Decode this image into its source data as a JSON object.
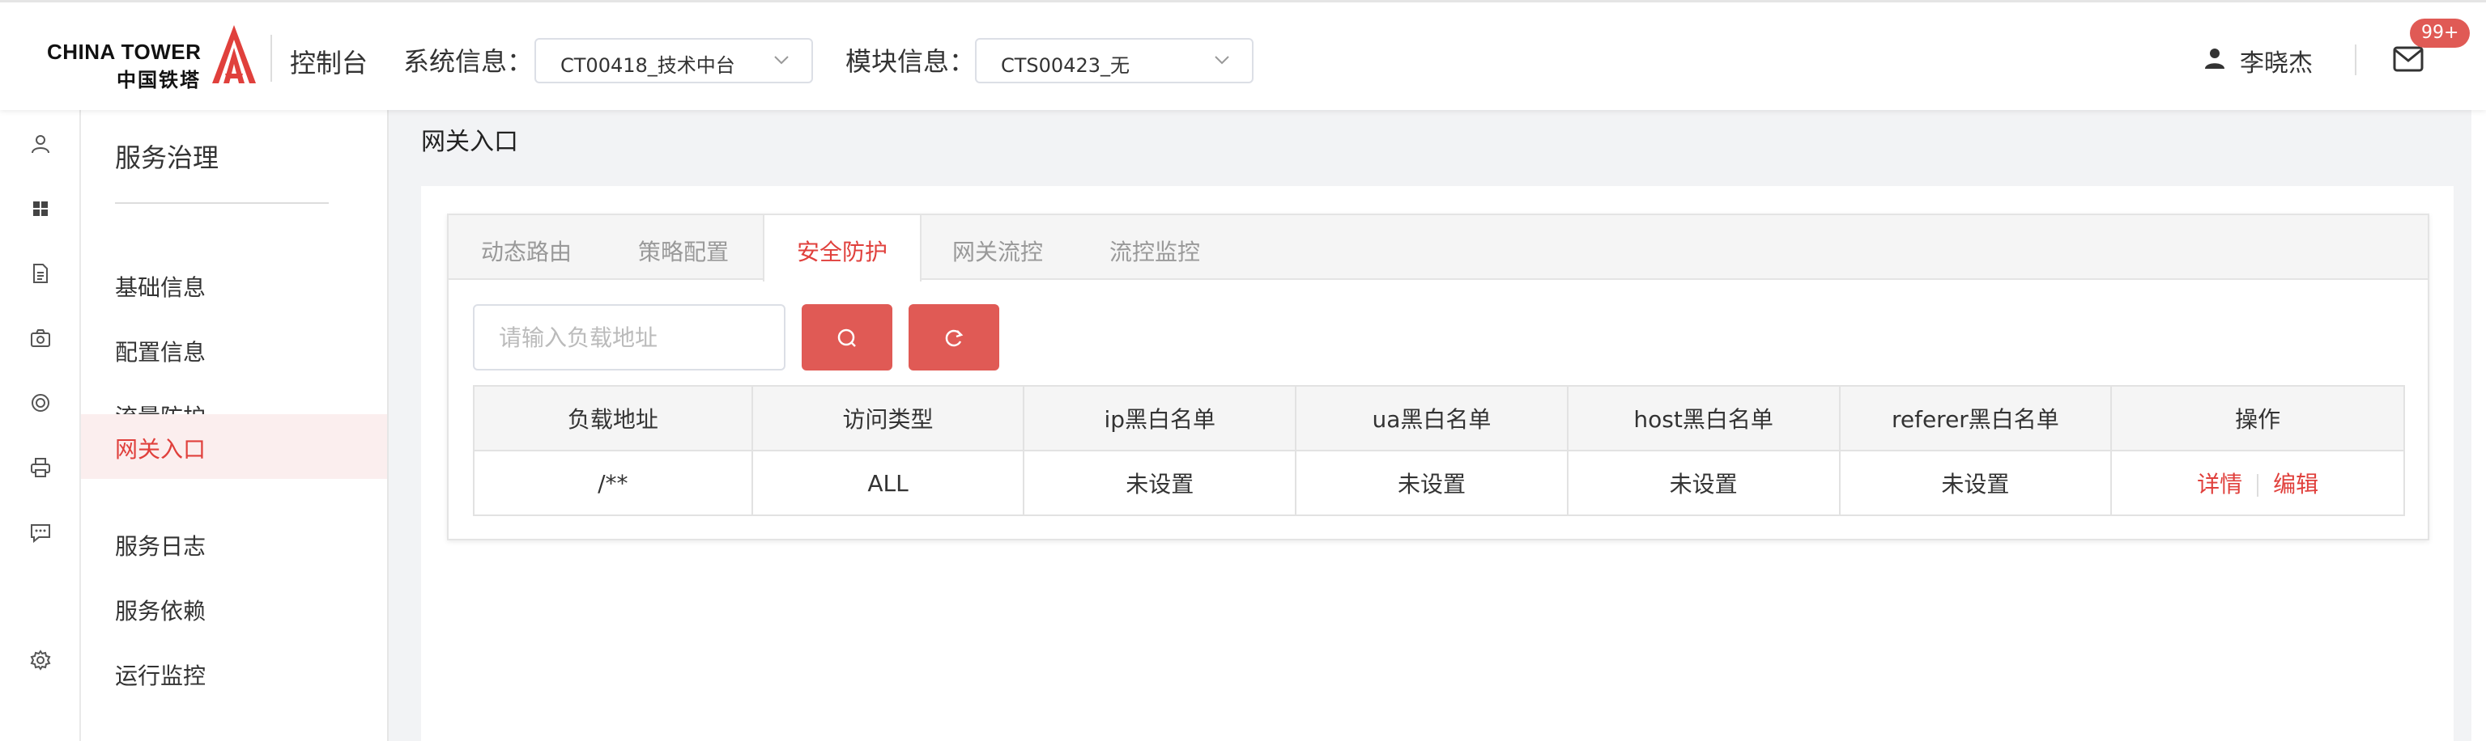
{
  "header": {
    "logo_en": "CHINA TOWER",
    "logo_cn": "中国铁塔",
    "console_title": "控制台",
    "system_label": "系统信息：",
    "system_value": "CT00418_技术中台",
    "module_label": "模块信息：",
    "module_value": "CTS00423_无",
    "user_name": "李晓杰",
    "mail_badge": "99+"
  },
  "sidebar": {
    "title": "服务治理",
    "items": [
      {
        "label": "基础信息"
      },
      {
        "label": "配置信息"
      },
      {
        "label": "流量防护"
      },
      {
        "label": "网关入口"
      },
      {
        "label": "服务日志"
      },
      {
        "label": "服务依赖"
      },
      {
        "label": "运行监控"
      }
    ],
    "active_index": 3
  },
  "rail_icons": [
    "user-icon",
    "grid-icon",
    "document-icon",
    "camera-icon",
    "lifebuoy-icon",
    "printer-icon",
    "chat-icon",
    "gear-icon"
  ],
  "main": {
    "page_title": "网关入口",
    "tabs": [
      {
        "label": "动态路由"
      },
      {
        "label": "策略配置"
      },
      {
        "label": "安全防护"
      },
      {
        "label": "网关流控"
      },
      {
        "label": "流控监控"
      }
    ],
    "active_tab": 2,
    "search": {
      "placeholder": "请输入负载地址",
      "value": ""
    },
    "table": {
      "columns": [
        "负载地址",
        "访问类型",
        "ip黑白名单",
        "ua黑白名单",
        "host黑白名单",
        "referer黑白名单",
        "操作"
      ],
      "rows": [
        {
          "path": "/**",
          "type": "ALL",
          "ip": "未设置",
          "ua": "未设置",
          "host": "未设置",
          "referer": "未设置",
          "actions": [
            "详情",
            "编辑"
          ]
        }
      ]
    }
  },
  "colors": {
    "accent": "#e05a55",
    "active_text": "#e0403c",
    "active_bg": "#fbeeee"
  }
}
